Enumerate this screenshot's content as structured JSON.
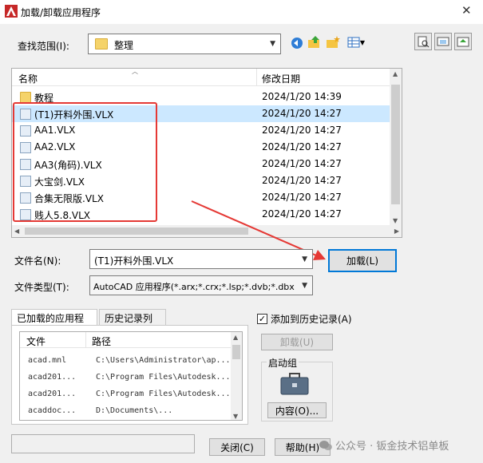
{
  "window": {
    "title": "加载/卸载应用程序",
    "close_glyph": "✕"
  },
  "lookin": {
    "label": "查找范围(I):",
    "value": "整理"
  },
  "filelist": {
    "col_name": "名称",
    "col_modified": "修改日期",
    "rows": [
      {
        "name": "教程",
        "date": "2024/1/20 14:39",
        "icon": "folder-icon",
        "selected": false
      },
      {
        "name": "(T1)开料外围.VLX",
        "date": "2024/1/20 14:27",
        "icon": "vlx-file-icon",
        "selected": true
      },
      {
        "name": "AA1.VLX",
        "date": "2024/1/20 14:27",
        "icon": "vlx-file-icon",
        "selected": false
      },
      {
        "name": "AA2.VLX",
        "date": "2024/1/20 14:27",
        "icon": "vlx-file-icon",
        "selected": false
      },
      {
        "name": "AA3(角码).VLX",
        "date": "2024/1/20 14:27",
        "icon": "vlx-file-icon",
        "selected": false
      },
      {
        "name": "大宝剑.VLX",
        "date": "2024/1/20 14:27",
        "icon": "vlx-file-icon",
        "selected": false
      },
      {
        "name": "合集无限版.VLX",
        "date": "2024/1/20 14:27",
        "icon": "vlx-file-icon",
        "selected": false
      },
      {
        "name": "贱人5.8.VLX",
        "date": "2024/1/20 14:27",
        "icon": "vlx-file-icon",
        "selected": false
      }
    ]
  },
  "filename": {
    "label": "文件名(N):",
    "value": "(T1)开料外围.VLX"
  },
  "filetype": {
    "label": "文件类型(T):",
    "value": "AutoCAD 应用程序(*.arx;*.crx;*.lsp;*.dvb;*.dbx"
  },
  "load_button": "加载(L)",
  "tabs": {
    "loaded": "已加载的应用程序",
    "history": "历史记录列表"
  },
  "applist": {
    "col_file": "文件",
    "col_path": "路径",
    "rows": [
      {
        "file": "acad.mnl",
        "path": "C:\\Users\\Administrator\\ap..."
      },
      {
        "file": "acad201...",
        "path": "C:\\Program Files\\Autodesk..."
      },
      {
        "file": "acad201...",
        "path": "C:\\Program Files\\Autodesk..."
      },
      {
        "file": "acaddoc...",
        "path": "D:\\Documents\\..."
      }
    ]
  },
  "add_history": {
    "label": "添加到历史记录(A)",
    "checked": true
  },
  "unload_button": "卸载(U)",
  "startup_group": {
    "label": "启动组",
    "contents_button": "内容(O)..."
  },
  "close_button": "关闭(C)",
  "help_button": "帮助(H)",
  "watermark": "公众号 · 钣金技术铝单板",
  "colors": {
    "selection": "#cce8ff",
    "highlight_box": "#e53935",
    "primary_border": "#0078d7"
  }
}
